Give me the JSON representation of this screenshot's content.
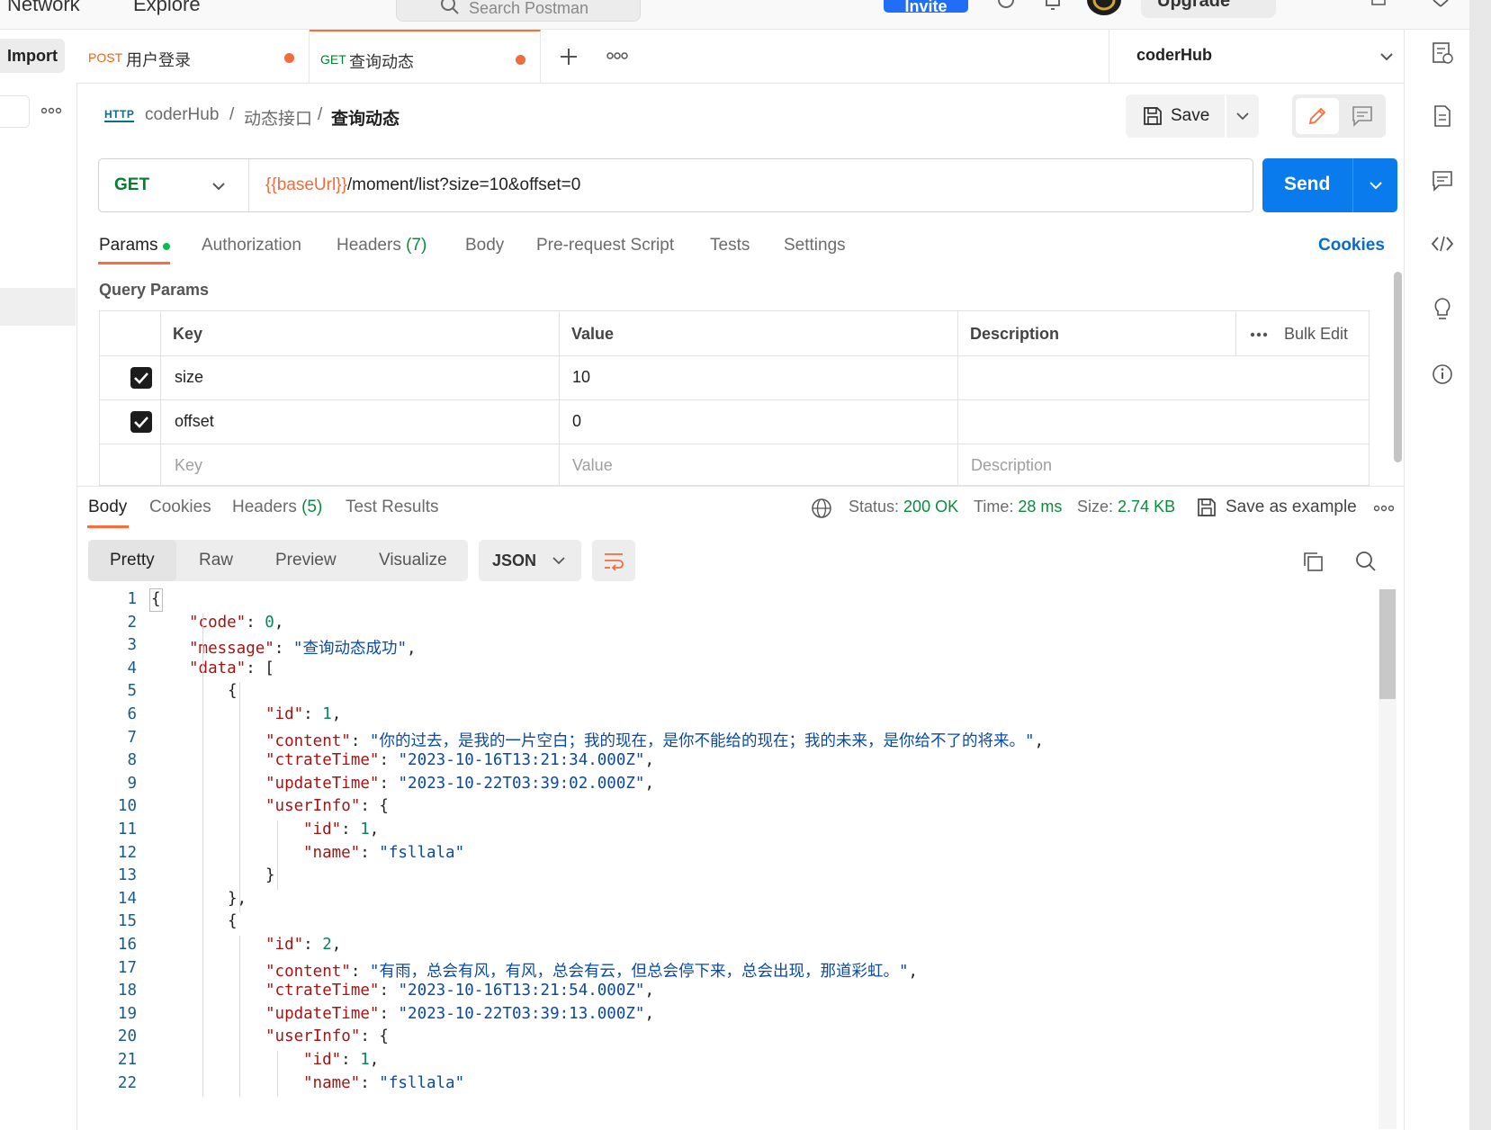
{
  "topbar": {
    "nav": [
      "Network",
      "Explore"
    ],
    "search_placeholder": "Search Postman",
    "invite_label": "Invite",
    "upgrade_label": "Upgrade"
  },
  "tabs": {
    "import_label": "Import",
    "items": [
      {
        "method": "POST",
        "title": "用户登录",
        "method_color": "#e8641b"
      },
      {
        "method": "GET",
        "title": "查询动态",
        "method_color": "#007f31"
      }
    ],
    "environment": "coderHub"
  },
  "breadcrumb": {
    "badge": "HTTP",
    "parts": [
      "coderHub",
      "动态接口"
    ],
    "current": "查询动态"
  },
  "toolbar": {
    "save_label": "Save"
  },
  "request": {
    "method": "GET",
    "url_var": "{{baseUrl}}",
    "url_rest": "/moment/list?size=10&offset=0",
    "send_label": "Send"
  },
  "request_tabs": {
    "params": "Params",
    "authorization": "Authorization",
    "headers": "Headers",
    "headers_count": "(7)",
    "body": "Body",
    "prerequest": "Pre-request Script",
    "tests": "Tests",
    "settings": "Settings",
    "cookies": "Cookies"
  },
  "query_params": {
    "label": "Query Params",
    "headers": {
      "key": "Key",
      "value": "Value",
      "description": "Description",
      "bulk_edit": "Bulk Edit"
    },
    "rows": [
      {
        "key": "size",
        "value": "10",
        "description": ""
      },
      {
        "key": "offset",
        "value": "0",
        "description": ""
      }
    ],
    "placeholder": {
      "key": "Key",
      "value": "Value",
      "description": "Description"
    }
  },
  "response": {
    "tabs": {
      "body": "Body",
      "cookies": "Cookies",
      "headers": "Headers",
      "headers_count": "(5)",
      "tests": "Test Results"
    },
    "status_label": "Status:",
    "status_value": "200 OK",
    "time_label": "Time:",
    "time_value": "28 ms",
    "size_label": "Size:",
    "size_value": "2.74 KB",
    "save_example": "Save as example",
    "formats": {
      "pretty": "Pretty",
      "raw": "Raw",
      "preview": "Preview",
      "visualize": "Visualize"
    },
    "language": "JSON"
  },
  "colors": {
    "accent": "#ff6c37",
    "send": "#097bed",
    "get": "#007f31",
    "status_ok": "#0a8c3c"
  },
  "code_lines": [
    [
      {
        "c": "p",
        "t": "{"
      }
    ],
    [
      {
        "c": "k",
        "t": "\"code\""
      },
      {
        "c": "p",
        "t": ": "
      },
      {
        "c": "n",
        "t": "0"
      },
      {
        "c": "p",
        "t": ","
      }
    ],
    [
      {
        "c": "k",
        "t": "\"message\""
      },
      {
        "c": "p",
        "t": ": "
      },
      {
        "c": "s",
        "t": "\"查询动态成功\""
      },
      {
        "c": "p",
        "t": ","
      }
    ],
    [
      {
        "c": "k",
        "t": "\"data\""
      },
      {
        "c": "p",
        "t": ": ["
      }
    ],
    [
      {
        "c": "p",
        "t": "{"
      }
    ],
    [
      {
        "c": "k",
        "t": "\"id\""
      },
      {
        "c": "p",
        "t": ": "
      },
      {
        "c": "n",
        "t": "1"
      },
      {
        "c": "p",
        "t": ","
      }
    ],
    [
      {
        "c": "k",
        "t": "\"content\""
      },
      {
        "c": "p",
        "t": ": "
      },
      {
        "c": "s",
        "t": "\"你的过去，是我的一片空白；我的现在，是你不能给的现在；我的未来，是你给不了的将来。\""
      },
      {
        "c": "p",
        "t": ","
      }
    ],
    [
      {
        "c": "k",
        "t": "\"ctrateTime\""
      },
      {
        "c": "p",
        "t": ": "
      },
      {
        "c": "s",
        "t": "\"2023-10-16T13:21:34.000Z\""
      },
      {
        "c": "p",
        "t": ","
      }
    ],
    [
      {
        "c": "k",
        "t": "\"updateTime\""
      },
      {
        "c": "p",
        "t": ": "
      },
      {
        "c": "s",
        "t": "\"2023-10-22T03:39:02.000Z\""
      },
      {
        "c": "p",
        "t": ","
      }
    ],
    [
      {
        "c": "k",
        "t": "\"userInfo\""
      },
      {
        "c": "p",
        "t": ": {"
      }
    ],
    [
      {
        "c": "k",
        "t": "\"id\""
      },
      {
        "c": "p",
        "t": ": "
      },
      {
        "c": "n",
        "t": "1"
      },
      {
        "c": "p",
        "t": ","
      }
    ],
    [
      {
        "c": "k",
        "t": "\"name\""
      },
      {
        "c": "p",
        "t": ": "
      },
      {
        "c": "s",
        "t": "\"fsllala\""
      }
    ],
    [
      {
        "c": "p",
        "t": "}"
      }
    ],
    [
      {
        "c": "p",
        "t": "},"
      }
    ],
    [
      {
        "c": "p",
        "t": "{"
      }
    ],
    [
      {
        "c": "k",
        "t": "\"id\""
      },
      {
        "c": "p",
        "t": ": "
      },
      {
        "c": "n",
        "t": "2"
      },
      {
        "c": "p",
        "t": ","
      }
    ],
    [
      {
        "c": "k",
        "t": "\"content\""
      },
      {
        "c": "p",
        "t": ": "
      },
      {
        "c": "s",
        "t": "\"有雨，总会有风，有风，总会有云，但总会停下来，总会出现，那道彩虹。\""
      },
      {
        "c": "p",
        "t": ","
      }
    ],
    [
      {
        "c": "k",
        "t": "\"ctrateTime\""
      },
      {
        "c": "p",
        "t": ": "
      },
      {
        "c": "s",
        "t": "\"2023-10-16T13:21:54.000Z\""
      },
      {
        "c": "p",
        "t": ","
      }
    ],
    [
      {
        "c": "k",
        "t": "\"updateTime\""
      },
      {
        "c": "p",
        "t": ": "
      },
      {
        "c": "s",
        "t": "\"2023-10-22T03:39:13.000Z\""
      },
      {
        "c": "p",
        "t": ","
      }
    ],
    [
      {
        "c": "k",
        "t": "\"userInfo\""
      },
      {
        "c": "p",
        "t": ": {"
      }
    ],
    [
      {
        "c": "k",
        "t": "\"id\""
      },
      {
        "c": "p",
        "t": ": "
      },
      {
        "c": "n",
        "t": "1"
      },
      {
        "c": "p",
        "t": ","
      }
    ],
    [
      {
        "c": "k",
        "t": "\"name\""
      },
      {
        "c": "p",
        "t": ": "
      },
      {
        "c": "s",
        "t": "\"fsllala\""
      }
    ]
  ]
}
